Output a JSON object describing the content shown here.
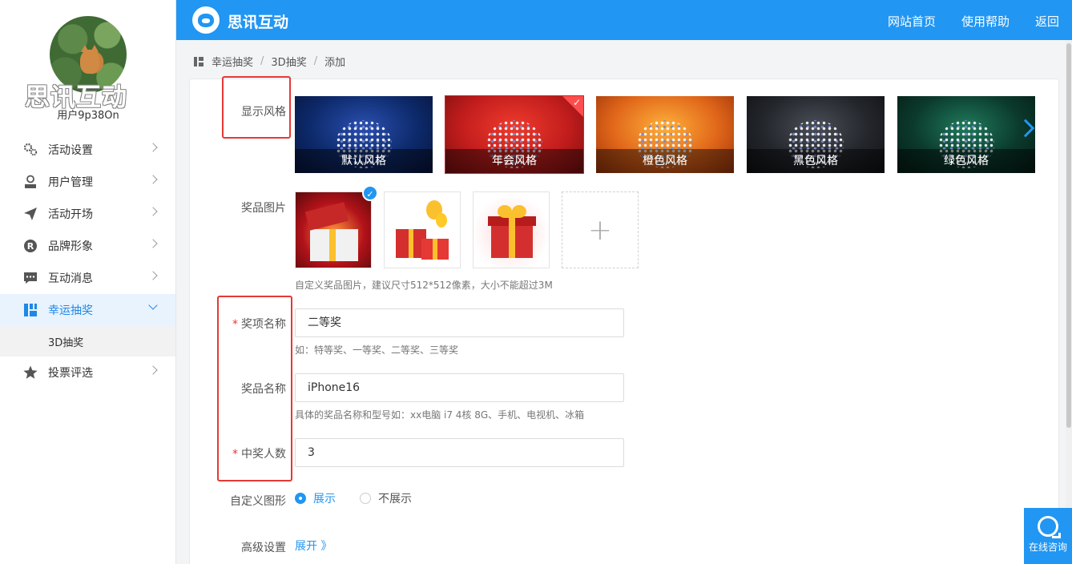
{
  "sidebar": {
    "brand_watermark": "思讯互动",
    "username": "用户9p38On",
    "menu": [
      {
        "label": "活动设置",
        "icon": "gears-icon"
      },
      {
        "label": "用户管理",
        "icon": "user-icon"
      },
      {
        "label": "活动开场",
        "icon": "paper-plane-icon"
      },
      {
        "label": "品牌形象",
        "icon": "registered-icon"
      },
      {
        "label": "互动消息",
        "icon": "message-icon"
      },
      {
        "label": "幸运抽奖",
        "icon": "lottery-icon",
        "active": true
      },
      {
        "label": "投票评选",
        "icon": "star-icon"
      }
    ],
    "submenu": {
      "label": "3D抽奖"
    }
  },
  "header": {
    "logo_text": "思讯互动",
    "nav": [
      "网站首页",
      "使用帮助",
      "返回"
    ]
  },
  "breadcrumb": [
    "幸运抽奖",
    "3D抽奖",
    "添加"
  ],
  "form": {
    "display_style": {
      "label": "显示风格",
      "options": [
        {
          "label": "默认风格",
          "bg": "#0d2a6b"
        },
        {
          "label": "年会风格",
          "bg": "#c21d1d",
          "selected": true
        },
        {
          "label": "橙色风格",
          "bg": "#e0661a"
        },
        {
          "label": "黑色风格",
          "bg": "#23262b"
        },
        {
          "label": "绿色风格",
          "bg": "#0b3a2c"
        }
      ]
    },
    "prize_image": {
      "label": "奖品图片",
      "hint": "自定义奖品图片，建议尺寸512*512像素，大小不能超过3M",
      "add_symbol": "+"
    },
    "award_name": {
      "required_mark": "*",
      "label": "奖项名称",
      "value": "二等奖",
      "hint": "如：特等奖、一等奖、二等奖、三等奖"
    },
    "prize_name": {
      "label": "奖品名称",
      "value": "iPhone16",
      "hint": "具体的奖品名称和型号如：xx电脑 i7 4核 8G、手机、电视机、冰箱"
    },
    "winner_count": {
      "required_mark": "*",
      "label": "中奖人数",
      "value": "3"
    },
    "custom_shape": {
      "label": "自定义图形",
      "option_show": "展示",
      "option_hide": "不展示",
      "selected": "展示"
    },
    "advanced": {
      "label": "高级设置",
      "toggle": "展开 》"
    }
  },
  "consult": {
    "label": "在线咨询"
  },
  "colors": {
    "primary": "#2196f3",
    "annotation": "#e53935"
  }
}
